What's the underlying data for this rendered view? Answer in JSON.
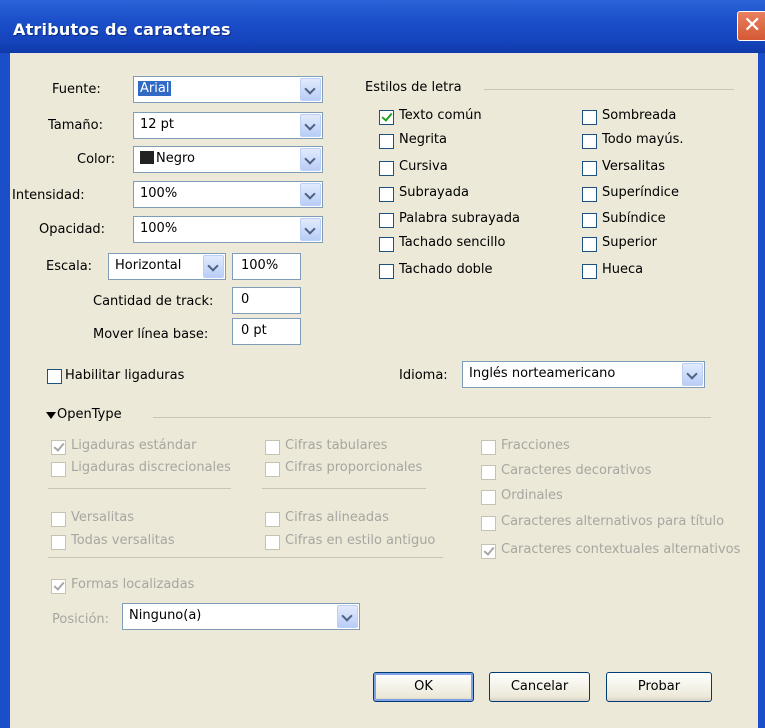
{
  "window": {
    "title": "Atributos de caracteres",
    "close_icon": "close-icon"
  },
  "font": {
    "fuente_label": "Fuente:",
    "fuente_value": "Arial",
    "tamano_label": "Tamaño:",
    "tamano_value": "12 pt",
    "color_label": "Color:",
    "color_value": "Negro",
    "intensidad_label": "Intensidad:",
    "intensidad_value": "100%",
    "opacidad_label": "Opacidad:",
    "opacidad_value": "100%",
    "escala_label": "Escala:",
    "escala_value": "Horizontal",
    "escala_pct": "100%",
    "track_label": "Cantidad de track:",
    "track_value": "0",
    "baseline_label": "Mover línea base:",
    "baseline_value": "0 pt"
  },
  "styles": {
    "heading": "Estilos de letra",
    "left": [
      {
        "label": "Texto común",
        "checked": true
      },
      {
        "label": "Negrita",
        "checked": false
      },
      {
        "label": "Cursiva",
        "checked": false
      },
      {
        "label": "Subrayada",
        "checked": false
      },
      {
        "label": "Palabra subrayada",
        "checked": false
      },
      {
        "label": "Tachado sencillo",
        "checked": false
      },
      {
        "label": "Tachado doble",
        "checked": false
      }
    ],
    "right": [
      {
        "label": "Sombreada",
        "checked": false
      },
      {
        "label": "Todo mayús.",
        "checked": false
      },
      {
        "label": "Versalitas",
        "checked": false
      },
      {
        "label": "Superíndice",
        "checked": false
      },
      {
        "label": "Subíndice",
        "checked": false
      },
      {
        "label": "Superior",
        "checked": false
      },
      {
        "label": "Hueca",
        "checked": false
      }
    ]
  },
  "ligatures": {
    "label": "Habilitar ligaduras",
    "checked": false
  },
  "language": {
    "label": "Idioma:",
    "value": "Inglés norteamericano"
  },
  "opentype": {
    "heading": "OpenType",
    "col1": [
      {
        "label": "Ligaduras estándar",
        "checked": true
      },
      {
        "label": "Ligaduras discrecionales",
        "checked": false
      },
      {
        "label": "Versalitas",
        "checked": false
      },
      {
        "label": "Todas versalitas",
        "checked": false
      }
    ],
    "col2": [
      {
        "label": "Cifras tabulares",
        "checked": false
      },
      {
        "label": "Cifras proporcionales",
        "checked": false
      },
      {
        "label": "Cifras alineadas",
        "checked": false
      },
      {
        "label": "Cifras en estilo antiguo",
        "checked": false
      }
    ],
    "col3": [
      {
        "label": "Fracciones",
        "checked": false
      },
      {
        "label": "Caracteres decorativos",
        "checked": false
      },
      {
        "label": "Ordinales",
        "checked": false
      },
      {
        "label": "Caracteres alternativos para título",
        "checked": false
      },
      {
        "label": "Caracteres contextuales alternativos",
        "checked": true
      }
    ],
    "formas": {
      "label": "Formas localizadas",
      "checked": true
    },
    "posicion_label": "Posición:",
    "posicion_value": "Ninguno(a)"
  },
  "buttons": {
    "ok": "OK",
    "cancel": "Cancelar",
    "test": "Probar"
  }
}
